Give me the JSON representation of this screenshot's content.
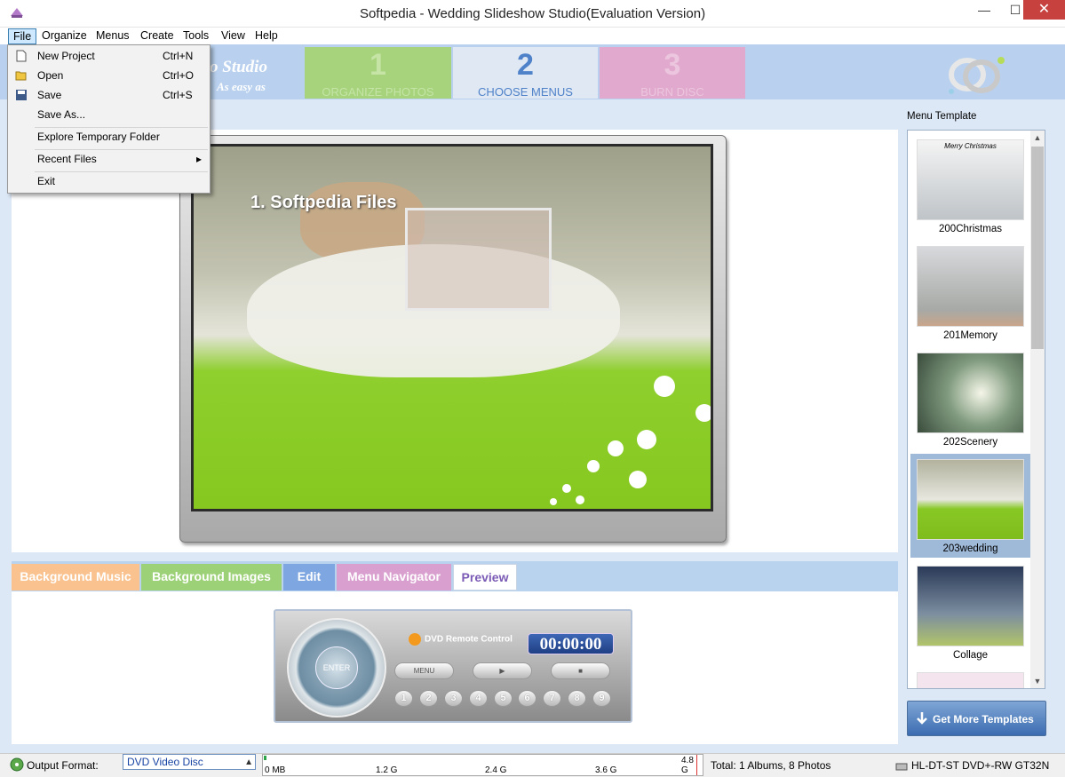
{
  "window": {
    "title": "Softpedia - Wedding Slideshow Studio(Evaluation Version)",
    "minimize_glyph": "—",
    "maximize_glyph": "☐",
    "close_glyph": "✕"
  },
  "menubar": [
    "File",
    "Organize",
    "Menus",
    "Create",
    "Tools",
    "View",
    "Help"
  ],
  "file_menu": {
    "items": [
      {
        "label": "New Project",
        "shortcut": "Ctrl+N",
        "icon": "new-file-icon"
      },
      {
        "label": "Open",
        "shortcut": "Ctrl+O",
        "icon": "open-folder-icon"
      },
      {
        "label": "Save",
        "shortcut": "Ctrl+S",
        "icon": "floppy-disk-icon"
      },
      {
        "label": "Save As...",
        "shortcut": ""
      },
      {
        "label": "Explore Temporary Folder",
        "shortcut": ""
      },
      {
        "label": "Recent Files",
        "shortcut": "",
        "submenu_arrow": "▸"
      },
      {
        "label": "Exit",
        "shortcut": ""
      }
    ]
  },
  "header": {
    "brand_line1": "o Studio",
    "brand_line2": "As easy as",
    "steps": [
      {
        "num": "1",
        "label": "ORGANIZE PHOTOS",
        "state": "inactive"
      },
      {
        "num": "2",
        "label": "CHOOSE MENUS",
        "state": "active"
      },
      {
        "num": "3",
        "label": "BURN  DISC",
        "state": "inactive"
      }
    ]
  },
  "preview": {
    "menu_item_text": "1. Softpedia Files"
  },
  "tabs": [
    "Background Music",
    "Background Images",
    "Edit",
    "Menu Navigator",
    "Preview"
  ],
  "active_tab": "Preview",
  "remote": {
    "title": "DVD Remote Control",
    "time": "00:00:00",
    "enter_label": "ENTER",
    "menu_label": "MENU",
    "play_glyph": "▶",
    "stop_glyph": "■",
    "numbers": [
      "1",
      "2",
      "3",
      "4",
      "5",
      "6",
      "7",
      "8",
      "9"
    ]
  },
  "templates": {
    "heading": "Menu Template",
    "items": [
      {
        "name": "200Christmas",
        "thumb_text": "Merry Christmas"
      },
      {
        "name": "201Memory"
      },
      {
        "name": "202Scenery"
      },
      {
        "name": "203wedding",
        "selected": true
      },
      {
        "name": "Collage"
      }
    ],
    "get_more": "Get More Templates ..."
  },
  "status": {
    "output_format_label": "Output Format:",
    "output_format_value": "DVD Video Disc",
    "ruler_ticks": [
      "0 MB",
      "1.2 G",
      "2.4 G",
      "3.6 G",
      "4.8 G"
    ],
    "disc_usage_fraction": 0.002,
    "total": "Total: 1 Albums, 8 Photos",
    "drive": "HL-DT-ST DVD+-RW GT32N"
  },
  "colors": {
    "accent": "#4f82c9",
    "header_bg": "#b9d1ee",
    "step1": "#a6d37c",
    "step3": "#e1a9cd",
    "tab_music": "#f9c28f",
    "tab_images": "#9dd178",
    "tab_edit": "#7ea6e0",
    "tab_navigator": "#d9a0cf"
  }
}
